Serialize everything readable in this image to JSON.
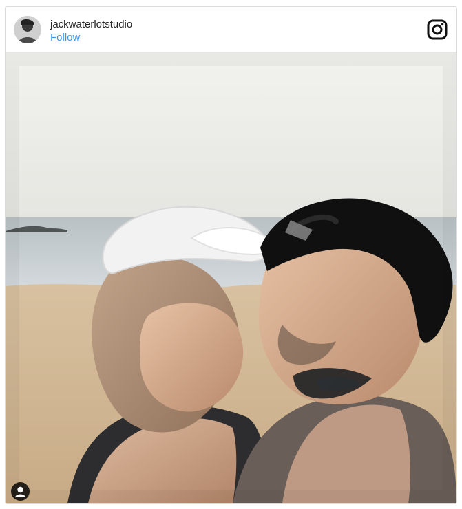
{
  "post": {
    "username": "jackwaterlotstudio",
    "follow_label": "Follow"
  },
  "icons": {
    "platform": "instagram-icon",
    "tagged_users": "user-tag-icon",
    "avatar": "avatar"
  },
  "colors": {
    "follow_link": "#3897f0",
    "username_text": "#262626",
    "border": "#dbdbdb"
  },
  "photo": {
    "description_hidden": true
  }
}
